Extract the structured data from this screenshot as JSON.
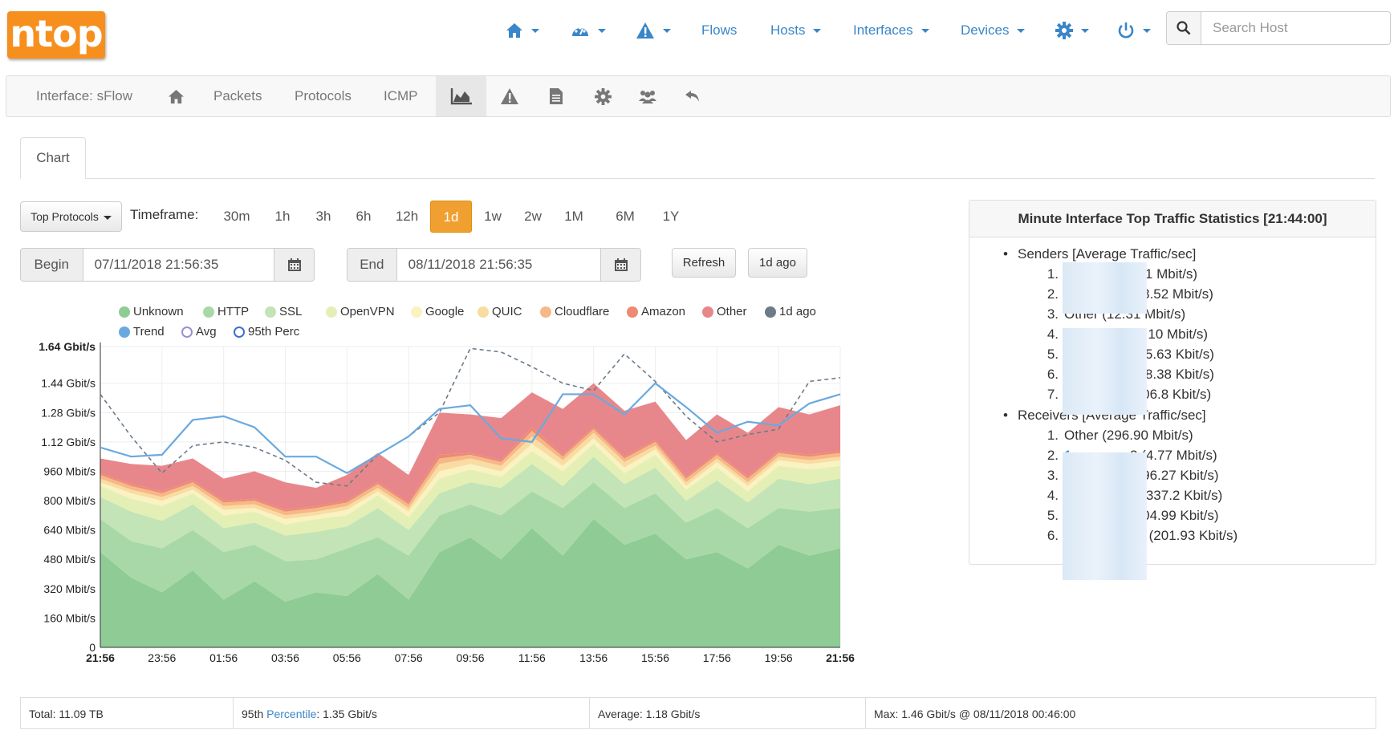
{
  "app": {
    "logo_text": "ntop"
  },
  "topnav": {
    "flows": "Flows",
    "hosts": "Hosts",
    "interfaces": "Interfaces",
    "devices": "Devices",
    "search_placeholder": "Search Host"
  },
  "subnav": {
    "interface": "Interface: sFlow",
    "packets": "Packets",
    "protocols": "Protocols",
    "icmp": "ICMP"
  },
  "tab": {
    "label": "Chart"
  },
  "controls": {
    "top_protocols": "Top Protocols",
    "timeframe_label": "Timeframe:",
    "timeframes": [
      "30m",
      "1h",
      "3h",
      "6h",
      "12h",
      "1d",
      "1w",
      "2w",
      "1M",
      "6M",
      "1Y"
    ],
    "active_timeframe": "1d",
    "begin_label": "Begin",
    "begin_value": "07/11/2018 21:56:35",
    "end_label": "End",
    "end_value": "08/11/2018 21:56:35",
    "refresh": "Refresh",
    "ago": "1d ago"
  },
  "colors": {
    "unknown": "#8fcb95",
    "http": "#a8d8a8",
    "ssl": "#c3e4b6",
    "openvpn": "#e4efb6",
    "google": "#faf2c0",
    "quic": "#f9dca2",
    "cloudflare": "#f6b887",
    "amazon": "#ee8a6f",
    "other": "#e8878b",
    "one_day_ago": "#6b7b8a",
    "trend": "#6aa9e0",
    "avg": "#9a8fd6",
    "perc95": "#3d6fd0",
    "accent": "#f0a030"
  },
  "chart_data": {
    "type": "area",
    "ylim": [
      0,
      1640
    ],
    "y_unit": "Mbit/s",
    "yticks": [
      {
        "v": 0,
        "label": "0"
      },
      {
        "v": 160,
        "label": "160 Mbit/s"
      },
      {
        "v": 320,
        "label": "320 Mbit/s"
      },
      {
        "v": 480,
        "label": "480 Mbit/s"
      },
      {
        "v": 640,
        "label": "640 Mbit/s"
      },
      {
        "v": 800,
        "label": "800 Mbit/s"
      },
      {
        "v": 960,
        "label": "960 Mbit/s"
      },
      {
        "v": 1120,
        "label": "1.12 Gbit/s"
      },
      {
        "v": 1280,
        "label": "1.28 Gbit/s"
      },
      {
        "v": 1440,
        "label": "1.44 Gbit/s"
      },
      {
        "v": 1640,
        "label": "1.64 Gbit/s"
      }
    ],
    "xticks": [
      "21:56",
      "23:56",
      "01:56",
      "03:56",
      "05:56",
      "07:56",
      "09:56",
      "11:56",
      "13:56",
      "15:56",
      "17:56",
      "19:56",
      "21:56"
    ],
    "legend": [
      {
        "key": "unknown",
        "name": "Unknown",
        "kind": "dot"
      },
      {
        "key": "http",
        "name": "HTTP",
        "kind": "dot"
      },
      {
        "key": "ssl",
        "name": "SSL",
        "kind": "dot"
      },
      {
        "key": "openvpn",
        "name": "OpenVPN",
        "kind": "dot"
      },
      {
        "key": "google",
        "name": "Google",
        "kind": "dot"
      },
      {
        "key": "quic",
        "name": "QUIC",
        "kind": "dot"
      },
      {
        "key": "cloudflare",
        "name": "Cloudflare",
        "kind": "dot"
      },
      {
        "key": "amazon",
        "name": "Amazon",
        "kind": "dot"
      },
      {
        "key": "other",
        "name": "Other",
        "kind": "dot"
      },
      {
        "key": "one_day_ago",
        "name": "1d ago",
        "kind": "dot"
      },
      {
        "key": "trend",
        "name": "Trend",
        "kind": "dot"
      },
      {
        "key": "avg",
        "name": "Avg",
        "kind": "ring"
      },
      {
        "key": "perc95",
        "name": "95th Perc",
        "kind": "ring"
      }
    ],
    "x_hours": [
      0,
      1,
      2,
      3,
      4,
      5,
      6,
      7,
      8,
      9,
      10,
      11,
      12,
      13,
      14,
      15,
      16,
      17,
      18,
      19,
      20,
      21,
      22,
      23,
      24
    ],
    "series": [
      {
        "name": "Unknown",
        "values": [
          520,
          380,
          300,
          420,
          260,
          360,
          250,
          300,
          280,
          400,
          260,
          520,
          600,
          480,
          650,
          500,
          700,
          560,
          620,
          480,
          520,
          430,
          560,
          500,
          540
        ]
      },
      {
        "name": "HTTP",
        "values": [
          180,
          200,
          240,
          220,
          260,
          200,
          220,
          180,
          260,
          200,
          240,
          200,
          180,
          240,
          200,
          260,
          200,
          200,
          220,
          200,
          240,
          220,
          200,
          240,
          220
        ]
      },
      {
        "name": "SSL",
        "values": [
          120,
          160,
          150,
          140,
          130,
          120,
          140,
          150,
          120,
          160,
          140,
          120,
          120,
          150,
          150,
          120,
          140,
          130,
          140,
          120,
          150,
          140,
          160,
          150,
          160
        ]
      },
      {
        "name": "OpenVPN",
        "values": [
          60,
          70,
          80,
          60,
          70,
          60,
          60,
          70,
          60,
          70,
          70,
          80,
          70,
          60,
          70,
          80,
          70,
          60,
          70,
          60,
          70,
          60,
          70,
          80,
          70
        ]
      },
      {
        "name": "Google",
        "values": [
          20,
          30,
          30,
          20,
          30,
          20,
          30,
          20,
          30,
          20,
          30,
          40,
          30,
          30,
          40,
          30,
          30,
          30,
          30,
          20,
          30,
          30,
          30,
          30,
          30
        ]
      },
      {
        "name": "QUIC",
        "values": [
          20,
          20,
          20,
          20,
          20,
          20,
          20,
          20,
          20,
          20,
          20,
          40,
          30,
          30,
          40,
          30,
          30,
          30,
          20,
          20,
          20,
          20,
          20,
          20,
          20
        ]
      },
      {
        "name": "Cloudflare",
        "values": [
          20,
          20,
          20,
          20,
          20,
          20,
          20,
          20,
          20,
          20,
          20,
          30,
          20,
          20,
          30,
          20,
          20,
          20,
          20,
          20,
          20,
          20,
          20,
          20,
          20
        ]
      },
      {
        "name": "Amazon",
        "values": [
          10,
          10,
          10,
          10,
          10,
          10,
          10,
          10,
          10,
          10,
          10,
          20,
          10,
          10,
          20,
          10,
          10,
          10,
          10,
          10,
          10,
          10,
          10,
          10,
          10
        ]
      },
      {
        "name": "Other",
        "values": [
          80,
          110,
          140,
          120,
          120,
          150,
          150,
          100,
          140,
          160,
          150,
          230,
          210,
          230,
          190,
          250,
          240,
          250,
          210,
          200,
          210,
          240,
          240,
          220,
          250
        ]
      }
    ],
    "trend_values": [
      1090,
      1040,
      1050,
      1240,
      1260,
      1200,
      1040,
      1040,
      950,
      1050,
      1150,
      1300,
      1320,
      1140,
      1120,
      1380,
      1380,
      1270,
      1440,
      1310,
      1170,
      1230,
      1210,
      1330,
      1380
    ],
    "one_day_ago_values": [
      1380,
      1150,
      950,
      1100,
      1120,
      1090,
      1020,
      900,
      880,
      1050,
      1150,
      1280,
      1630,
      1610,
      1530,
      1440,
      1400,
      1600,
      1450,
      1260,
      1120,
      1160,
      1190,
      1450,
      1470
    ]
  },
  "panel": {
    "title": "Minute Interface Top Traffic Statistics [21:44:00]",
    "senders_title": "Senders [Average Traffic/sec]",
    "senders": [
      {
        "n": "1.",
        "prefix": "1",
        "value": "121 Mbit/s)"
      },
      {
        "n": "2.",
        "prefix": "1",
        "value": "(13.52 Mbit/s)"
      },
      {
        "n": "3.",
        "prefix": "",
        "value": "Other (12.31 Mbit/s)"
      },
      {
        "n": "4.",
        "prefix": "1",
        "value": "11.10 Mbit/s)"
      },
      {
        "n": "5.",
        "prefix": "1",
        "value": "855.63 Kbit/s)"
      },
      {
        "n": "6.",
        "prefix": "1",
        "value": "698.38 Kbit/s)"
      },
      {
        "n": "7.",
        "prefix": "1",
        "value": "(506.8 Kbit/s)"
      }
    ],
    "receivers_title": "Receivers [Average Traffic/sec]",
    "receivers": [
      {
        "n": "1.",
        "prefix": "",
        "value": "Other (296.90 Mbit/s)"
      },
      {
        "n": "2.",
        "prefix": "1",
        "value": "2 (4.77 Mbit/s)"
      },
      {
        "n": "3.",
        "prefix": "1",
        "value": "(596.27 Kbit/s)"
      },
      {
        "n": "4.",
        "prefix": "8",
        "value": "0 (337.2 Kbit/s)"
      },
      {
        "n": "5.",
        "prefix": "8",
        "value": "(304.99 Kbit/s)"
      },
      {
        "n": "6.",
        "prefix": "8",
        "value": "20 (201.93 Kbit/s)"
      }
    ]
  },
  "footer": {
    "total": "Total: 11.09 TB",
    "perc_prefix": "95th ",
    "perc_link": "Percentile",
    "perc_value": ": 1.35 Gbit/s",
    "average": "Average: 1.18 Gbit/s",
    "max": "Max: 1.46 Gbit/s @ 08/11/2018 00:46:00"
  }
}
